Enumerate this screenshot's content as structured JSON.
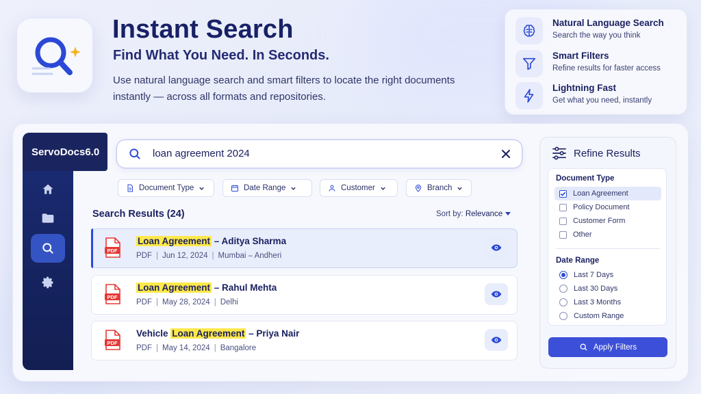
{
  "hero": {
    "title": "Instant Search",
    "subtitle": "Find What You Need. In Seconds.",
    "description": "Use natural language search and smart filters to locate the right documents instantly — across all formats and repositories."
  },
  "features": [
    {
      "title": "Natural Language Search",
      "desc": "Search the way you think",
      "icon": "brain-icon"
    },
    {
      "title": "Smart Filters",
      "desc": "Refine results for faster access",
      "icon": "filter-icon"
    },
    {
      "title": "Lightning Fast",
      "desc": "Get what you need, instantly",
      "icon": "lightning-icon"
    }
  ],
  "app": {
    "brand": "ServoDocs6.0",
    "nav": [
      "home-icon",
      "folder-icon",
      "search-icon",
      "gear-icon"
    ],
    "active_nav": "search-icon"
  },
  "search": {
    "query": "loan agreement 2024"
  },
  "filters": [
    {
      "label": "Document Type",
      "icon": "document-icon"
    },
    {
      "label": "Date Range",
      "icon": "calendar-icon"
    },
    {
      "label": "Customer",
      "icon": "user-icon"
    },
    {
      "label": "Branch",
      "icon": "location-pin-icon"
    }
  ],
  "results": {
    "heading": "Search Results (24)",
    "sort_label": "Sort by:",
    "sort_value": "Relevance",
    "items": [
      {
        "prefix": "",
        "highlight": "Loan Agreement",
        "suffix": " – Aditya Sharma",
        "type": "PDF",
        "date": "Jun 12, 2024",
        "location": "Mumbai – Andheri",
        "icon_label": "PDF"
      },
      {
        "prefix": "",
        "highlight": "Loan Agreement",
        "suffix": " – Rahul Mehta",
        "type": "PDF",
        "date": "May 28, 2024",
        "location": "Delhi",
        "icon_label": "PDF"
      },
      {
        "prefix": "Vehicle ",
        "highlight": "Loan Agreement",
        "suffix": " – Priya Nair",
        "type": "PDF",
        "date": "May 14, 2024",
        "location": "Bangalore",
        "icon_label": "PDF"
      }
    ]
  },
  "refine": {
    "title": "Refine Results",
    "doc_type_heading": "Document Type",
    "doc_types": [
      {
        "label": "Loan Agreement",
        "checked": true
      },
      {
        "label": "Policy Document",
        "checked": false
      },
      {
        "label": "Customer Form",
        "checked": false
      },
      {
        "label": "Other",
        "checked": false
      }
    ],
    "date_heading": "Date Range",
    "dates": [
      {
        "label": "Last 7 Days",
        "selected": true
      },
      {
        "label": "Last 30 Days",
        "selected": false
      },
      {
        "label": "Last 3 Months",
        "selected": false
      },
      {
        "label": "Custom Range",
        "selected": false
      }
    ],
    "apply_label": "Apply Filters"
  },
  "colors": {
    "accent": "#3b4fd8",
    "sidebar": "#15235f",
    "highlight": "#fde84a",
    "pdf": "#e53935"
  }
}
